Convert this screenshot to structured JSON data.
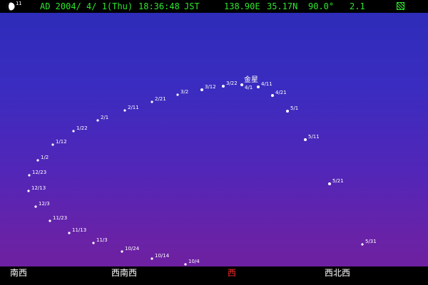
{
  "statusbar": {
    "moon_age": "11",
    "date": "AD 2004/ 4/ 1(Thu)",
    "time": "18:36:48",
    "timezone": "JST",
    "longitude": "138.90E",
    "latitude": "35.17N",
    "view_angle": "90.0°",
    "magnification": "2.1",
    "text_color": "#2ee62e"
  },
  "planet": {
    "name": "金星"
  },
  "path_points": [
    {
      "label": "12/3"
    },
    {
      "label": "12/13"
    },
    {
      "label": "12/23"
    },
    {
      "label": "1/2"
    },
    {
      "label": "1/12"
    },
    {
      "label": "1/22"
    },
    {
      "label": "2/1"
    },
    {
      "label": "2/11"
    },
    {
      "label": "2/21"
    },
    {
      "label": "3/2"
    },
    {
      "label": "3/12"
    },
    {
      "label": "3/22"
    },
    {
      "label": "4/1"
    },
    {
      "label": "4/11"
    },
    {
      "label": "4/21"
    },
    {
      "label": "5/1"
    },
    {
      "label": "5/11"
    },
    {
      "label": "5/21"
    },
    {
      "label": "5/31"
    },
    {
      "label": "11/23"
    },
    {
      "label": "11/13"
    },
    {
      "label": "11/3"
    },
    {
      "label": "10/24"
    },
    {
      "label": "10/14"
    },
    {
      "label": "10/4"
    }
  ],
  "directions": [
    {
      "label": "南西"
    },
    {
      "label": "西南西"
    },
    {
      "label": "西"
    },
    {
      "label": "西北西"
    }
  ],
  "colors": {
    "west_highlight": "#ff2a2a",
    "star": "#ffffff"
  }
}
